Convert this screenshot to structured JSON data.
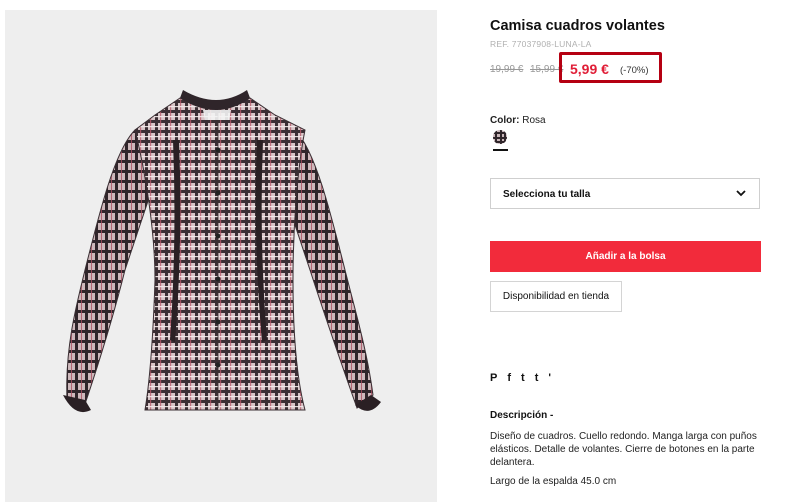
{
  "product": {
    "title": "Camisa cuadros volantes",
    "ref": "REF. 77037908-LUNA-LA",
    "image_alt": "shirt-image",
    "prices": {
      "original": "19,99 €",
      "previous": "15,99 €",
      "current": "5,99 €",
      "discount": "(-70%)",
      "current_color": "#e01e37",
      "highlight_border_color": "#b50012"
    }
  },
  "color": {
    "label": "Color:",
    "value": "Rosa",
    "swatch_icon": "plaid-swatch-icon"
  },
  "size_select": {
    "label": "Selecciona tu talla",
    "icon": "chevron-down-icon"
  },
  "buttons": {
    "add_to_bag": "Añadir a la bolsa",
    "add_to_bag_color": "#f22b3b",
    "availability": "Disponibilidad en tienda"
  },
  "share": {
    "icons": [
      {
        "name": "pinterest-icon",
        "glyph": "P"
      },
      {
        "name": "facebook-icon",
        "glyph": "f"
      },
      {
        "name": "twitter-icon",
        "glyph": "t"
      },
      {
        "name": "tumblr-icon",
        "glyph": "t"
      },
      {
        "name": "more-share-icon",
        "glyph": "'"
      }
    ]
  },
  "description": {
    "heading": "Descripción -",
    "text": "Diseño de cuadros. Cuello redondo. Manga larga con puños elásticos. Detalle de volantes. Cierre de botones en la parte delantera.",
    "measure": "Largo de la espalda 45.0 cm"
  }
}
